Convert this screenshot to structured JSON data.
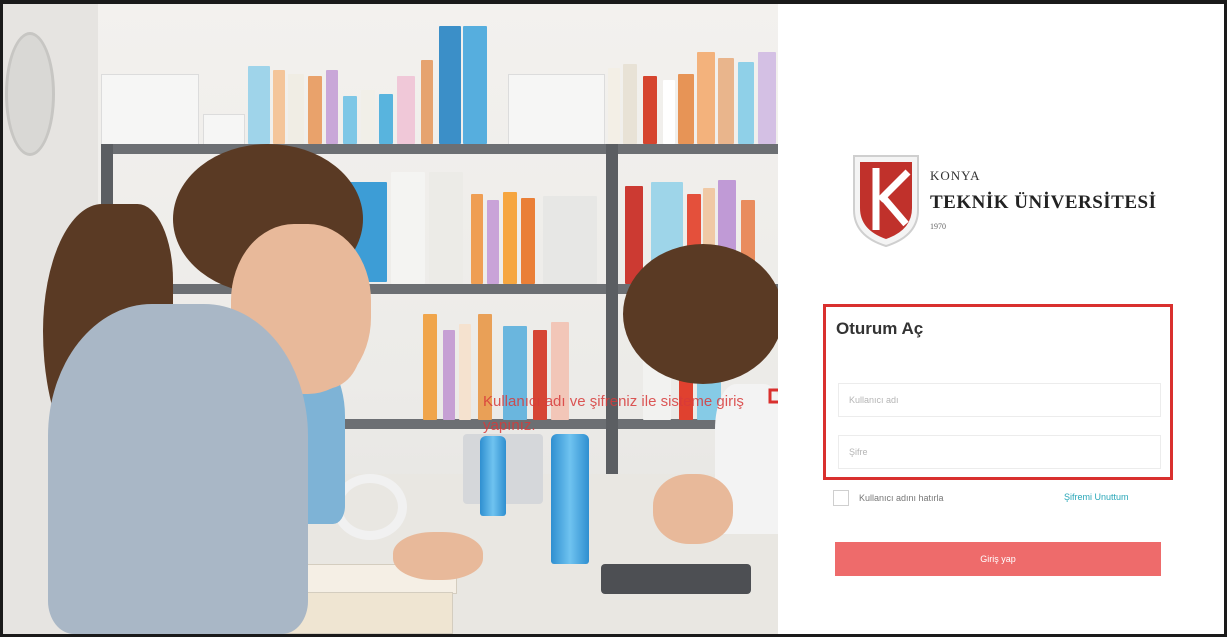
{
  "branding": {
    "line1": "KONYA",
    "line2": "TEKNİK ÜNİVERSİTESİ",
    "line3": "1970",
    "accent_color": "#c0312b"
  },
  "annotation": {
    "text": "Kullanıcı adı ve şifreniz ile sisteme giriş yapınız."
  },
  "login": {
    "title": "Oturum Aç",
    "username_placeholder": "Kullanıcı adı",
    "password_placeholder": "Şifre",
    "remember_label": "Kullanıcı adını hatırla",
    "forgot_link": "Şifremi Unuttum",
    "submit_label": "Giriş yap",
    "submit_color": "#ee6b6b",
    "highlight_color": "#d9302e"
  }
}
